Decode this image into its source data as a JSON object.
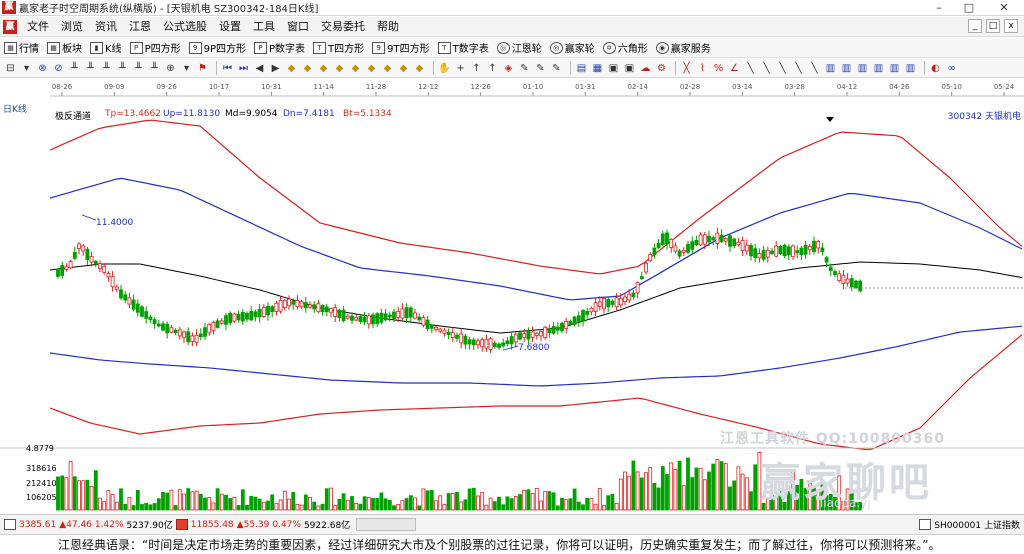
{
  "window": {
    "title": "赢家老子时空周期系统(纵横版) - [天银机电  SZ300342-184日K线]",
    "controls": [
      "–",
      "□",
      "✕"
    ]
  },
  "menu": {
    "items": [
      "文件",
      "浏览",
      "资讯",
      "江恩",
      "公式选股",
      "设置",
      "工具",
      "窗口",
      "交易委托",
      "帮助"
    ]
  },
  "toolbar1": {
    "items": [
      {
        "icon": "grid-icon",
        "label": "行情"
      },
      {
        "icon": "grid-icon",
        "label": "板块"
      },
      {
        "icon": "candle-icon",
        "label": "K线"
      },
      {
        "icon": "square-icon",
        "label": "P四方形"
      },
      {
        "icon": "square-icon",
        "label": "9P四方形"
      },
      {
        "icon": "square-icon",
        "label": "P数字表"
      },
      {
        "icon": "square-icon",
        "label": "T四方形"
      },
      {
        "icon": "square-icon",
        "label": "9T四方形"
      },
      {
        "icon": "square-icon",
        "label": "T数字表"
      },
      {
        "icon": "wheel-icon",
        "label": "江恩轮"
      },
      {
        "icon": "wheel-icon",
        "label": "赢家轮"
      },
      {
        "icon": "wheel-icon",
        "label": "六角形"
      },
      {
        "icon": "wheel-icon",
        "label": "赢家服务"
      }
    ]
  },
  "chart": {
    "period": "日K线",
    "indicator": {
      "name": "极反通道",
      "tp": "Tp=13.4662",
      "up": "Up=11.8130",
      "md": "Md=9.9054",
      "dn": "Dn=7.4181",
      "bt": "Bt=5.1334"
    },
    "stock": "300342  天银机电",
    "date_ticks": [
      "08-26",
      "09-09",
      "09-26",
      "10-17",
      "10-31",
      "11-14",
      "11-28",
      "12-12",
      "12-26",
      "01-10",
      "01-31",
      "02-14",
      "02-28",
      "03-14",
      "03-28",
      "04-12",
      "04-26",
      "05-10",
      "05-24"
    ],
    "high_label": "11.4000",
    "low_label": "7.6800",
    "volume_labels": [
      "4.8779",
      "318616",
      "212410",
      "106205"
    ],
    "watermark": {
      "line1": "江恩工具软件  QQ:100800360",
      "line2": "赢家聊吧",
      "line3": "liaoba.yj"
    },
    "colors": {
      "up": "#e02020",
      "down": "#00a000",
      "outer_band": "#d82020",
      "inner_band": "#2030c0",
      "mid": "#000000"
    }
  },
  "statusbar": {
    "sh_index": "3385.61",
    "sh_change": "▲47.46",
    "sh_pct": "1.42%",
    "sh_amount": "5237.90亿",
    "sz_index": "11855.48",
    "sz_change": "▲55.39",
    "sz_pct": "0.47%",
    "sz_amount": "5922.68亿",
    "right_label": "SH000001 上证指数"
  },
  "quote": {
    "text": "江恩经典语录：“时间是决定市场走势的重要因素，经过详细研究大市及个别股票的过往记录，你将可以证明，历史确实重复发生；而了解过往，你将可以预测将来。”。"
  }
}
